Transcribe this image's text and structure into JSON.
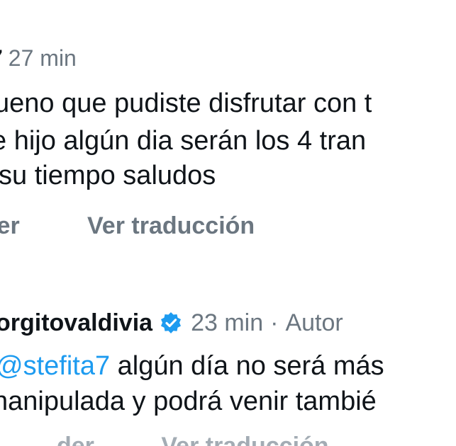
{
  "comment1": {
    "username_fragment": "7",
    "time": "27 min",
    "lines": [
      "ueno que pudiste disfrutar con t",
      "e hijo algún dia serán los 4 tran",
      "su tiempo saludos"
    ],
    "reply_label": "nder",
    "translate_label": "Ver traducción"
  },
  "comment2": {
    "username": "orgitovaldivia",
    "verified_icon": "verified-badge-icon",
    "time": "23 min",
    "separator": "·",
    "author_label": "Autor",
    "mention": "@stefita7",
    "line1_rest": " algún día no será más",
    "line2": "nanipulada y podrá venir tambié",
    "actions_partial": "der          Ver traducción"
  },
  "colors": {
    "text": "#0f1419",
    "muted": "#6b7680",
    "link": "#1d9bf0",
    "badge": "#1d9bf0"
  }
}
